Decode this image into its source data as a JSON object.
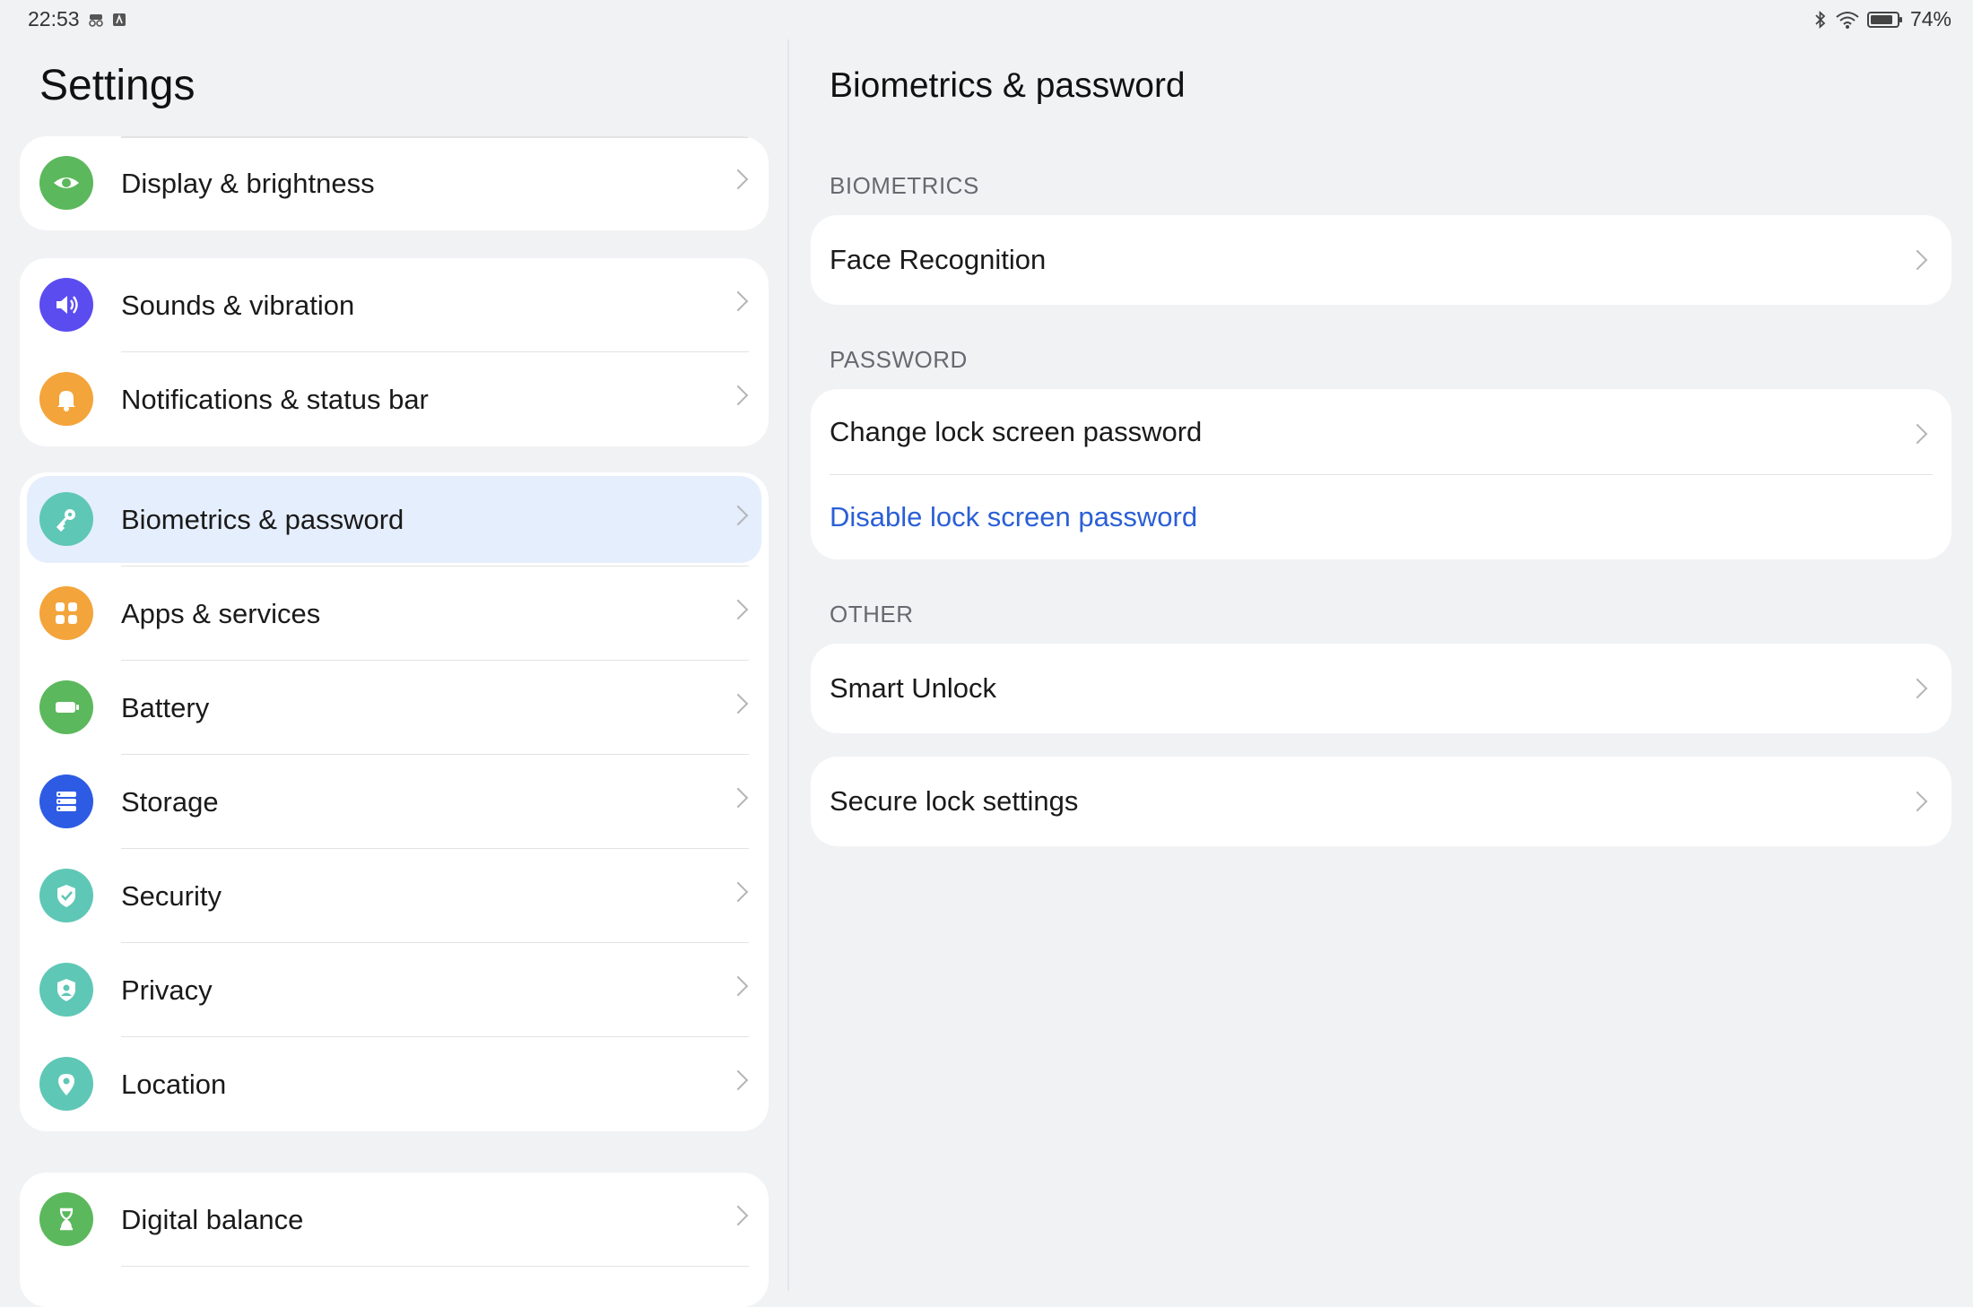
{
  "status_bar": {
    "time": "22:53",
    "battery": "74%"
  },
  "left": {
    "title": "Settings",
    "groups": [
      {
        "items": [
          {
            "label": "Display & brightness",
            "icon": "eye-icon",
            "color": "#5cb85c"
          }
        ]
      },
      {
        "items": [
          {
            "label": "Sounds & vibration",
            "icon": "speaker-icon",
            "color": "#5b4cf0"
          },
          {
            "label": "Notifications & status bar",
            "icon": "bell-icon",
            "color": "#f3a43b"
          }
        ]
      },
      {
        "items": [
          {
            "label": "Biometrics & password",
            "icon": "key-icon",
            "color": "#5fc7b6",
            "selected": true
          },
          {
            "label": "Apps & services",
            "icon": "apps-grid-icon",
            "color": "#f3a43b"
          },
          {
            "label": "Battery",
            "icon": "battery-icon",
            "color": "#5cb85c"
          },
          {
            "label": "Storage",
            "icon": "storage-icon",
            "color": "#2d5be3"
          },
          {
            "label": "Security",
            "icon": "shield-check-icon",
            "color": "#5fc7b6"
          },
          {
            "label": "Privacy",
            "icon": "privacy-shield-icon",
            "color": "#5fc7b6"
          },
          {
            "label": "Location",
            "icon": "location-pin-icon",
            "color": "#5fc7b6"
          }
        ]
      },
      {
        "items": [
          {
            "label": "Digital balance",
            "icon": "hourglass-icon",
            "color": "#5cb85c"
          }
        ]
      }
    ]
  },
  "right": {
    "title": "Biometrics & password",
    "sections": [
      {
        "header": "BIOMETRICS",
        "cards": [
          [
            {
              "label": "Face Recognition"
            }
          ]
        ]
      },
      {
        "header": "PASSWORD",
        "cards": [
          [
            {
              "label": "Change lock screen password"
            },
            {
              "label": "Disable lock screen password"
            }
          ]
        ]
      },
      {
        "header": "OTHER",
        "cards": [
          [
            {
              "label": "Smart Unlock"
            }
          ],
          [
            {
              "label": "Secure lock settings"
            }
          ]
        ]
      }
    ]
  }
}
